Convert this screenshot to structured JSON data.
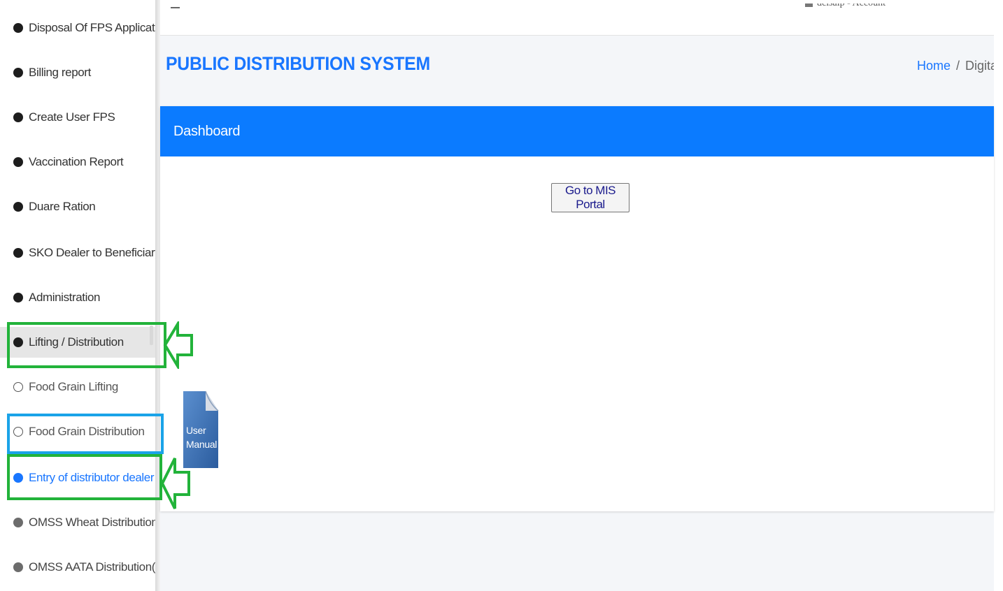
{
  "sidebar": {
    "items": [
      {
        "label": "Disposal Of FPS Applications"
      },
      {
        "label": "Billing report"
      },
      {
        "label": "Create User FPS"
      },
      {
        "label": "Vaccination Report"
      },
      {
        "label": "Duare Ration"
      },
      {
        "label": "SKO Dealer to Beneficiary Map"
      },
      {
        "label": "Administration"
      },
      {
        "label": "Lifting / Distribution"
      },
      {
        "label": "Food Grain Lifting"
      },
      {
        "label": "Food Grain Distribution"
      },
      {
        "label": "Entry of distributor dealer distribution"
      },
      {
        "label": "OMSS Wheat Distribution(Incl"
      },
      {
        "label": "OMSS AATA Distribution(Inclu"
      }
    ]
  },
  "header": {
    "user_text": "dcisaip  -  Account"
  },
  "page": {
    "title": "PUBLIC DISTRIBUTION SYSTEM",
    "breadcrumb_home": "Home",
    "breadcrumb_sep": "/",
    "breadcrumb_current": "Digital"
  },
  "card": {
    "header": "Dashboard",
    "button_label": "Go to MIS Portal",
    "manual_line1": "User",
    "manual_line2": "Manual"
  },
  "colors": {
    "brand_blue": "#0b7bff",
    "annotation_green": "#22b33a",
    "annotation_cyan": "#1aa3e8"
  },
  "icons": [
    "menu-icon",
    "user-icon",
    "bullet-dot-icon",
    "hollow-circle-icon",
    "document-icon",
    "arrow-left-icon"
  ]
}
